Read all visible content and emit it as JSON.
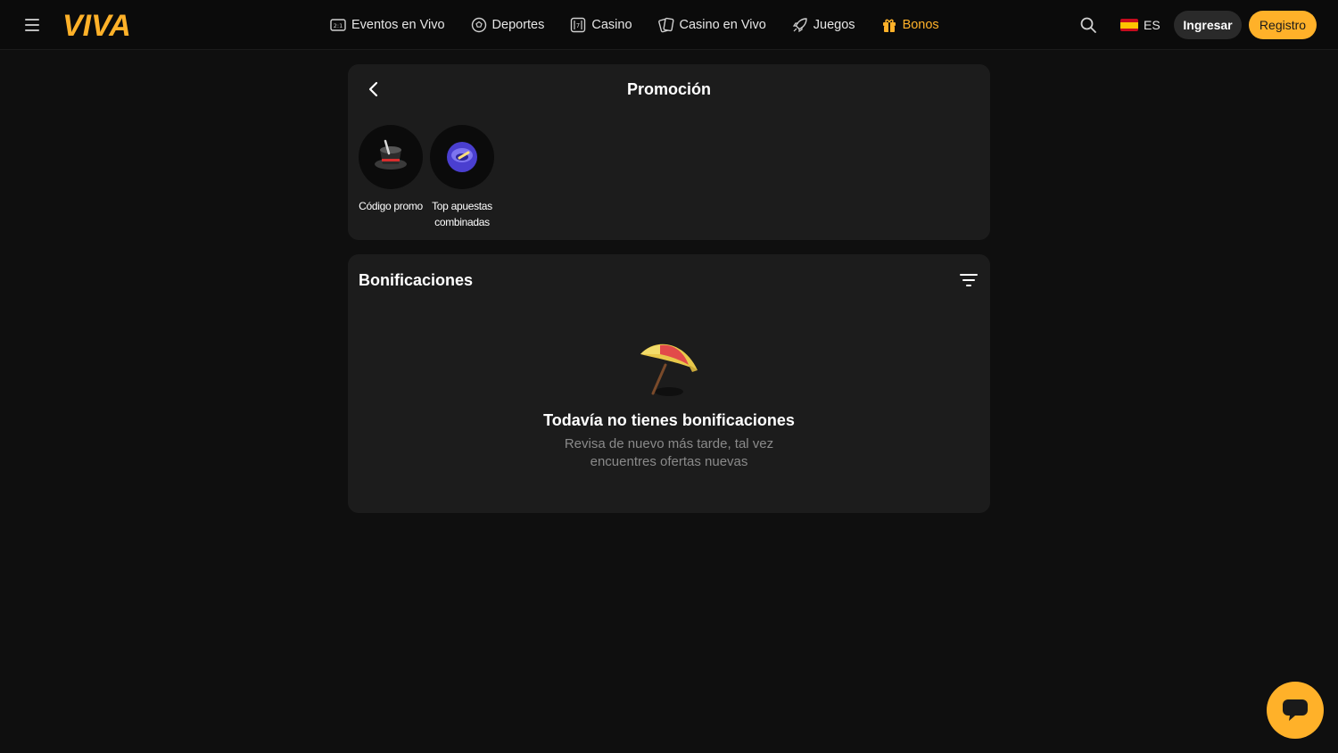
{
  "header": {
    "logo_text": "VIVA",
    "nav": [
      {
        "label": "Eventos en Vivo",
        "icon": "live-events-icon"
      },
      {
        "label": "Deportes",
        "icon": "soccer-ball-icon"
      },
      {
        "label": "Casino",
        "icon": "slot-icon"
      },
      {
        "label": "Casino en Vivo",
        "icon": "cards-icon"
      },
      {
        "label": "Juegos",
        "icon": "rocket-icon"
      },
      {
        "label": "Bonos",
        "icon": "gift-icon",
        "active": true
      }
    ],
    "language": "ES",
    "login_label": "Ingresar",
    "register_label": "Registro"
  },
  "promo": {
    "title": "Promoción",
    "items": [
      {
        "label": "Código promo",
        "icon": "magic-hat-icon"
      },
      {
        "label": "Top apuestas combinadas",
        "icon": "blue-bowl-icon"
      }
    ]
  },
  "bonuses": {
    "title": "Bonificaciones",
    "empty_title": "Todavía no tienes bonificaciones",
    "empty_subtitle": "Revisa de nuevo más tarde, tal vez encuentres ofertas nuevas"
  },
  "colors": {
    "accent": "#ffb129",
    "background": "#0f0f0f",
    "card": "#1c1c1c"
  }
}
